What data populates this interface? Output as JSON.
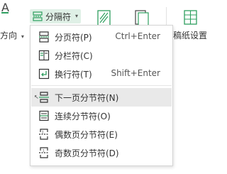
{
  "ribbon": {
    "orientation_label": "方向",
    "separator_label": "分隔符",
    "grid_label": "稿纸设置"
  },
  "menu": {
    "items": [
      {
        "label": "分页符(P)",
        "shortcut": "Ctrl+Enter",
        "icon": "page-break-icon"
      },
      {
        "label": "分栏符(C)",
        "shortcut": "",
        "icon": "column-break-icon"
      },
      {
        "label": "换行符(T)",
        "shortcut": "Shift+Enter",
        "icon": "line-break-icon"
      },
      {
        "label": "下一页分节符(N)",
        "shortcut": "",
        "icon": "next-page-section-icon"
      },
      {
        "label": "连续分节符(O)",
        "shortcut": "",
        "icon": "continuous-section-icon"
      },
      {
        "label": "偶数页分节符(E)",
        "shortcut": "",
        "icon": "even-page-section-icon"
      },
      {
        "label": "奇数页分节符(D)",
        "shortcut": "",
        "icon": "odd-page-section-icon"
      }
    ]
  },
  "colors": {
    "accent_green": "#2e9f5f",
    "hover_gray": "#e9e9e9",
    "button_highlight": "#dff0e6"
  }
}
